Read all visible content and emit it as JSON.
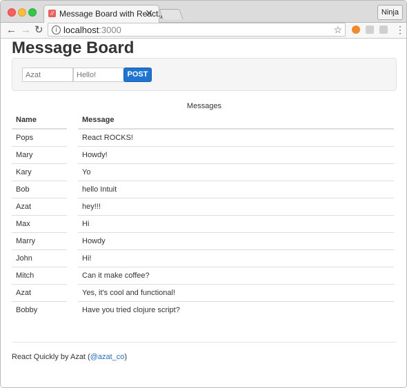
{
  "browser": {
    "tab_title": "Message Board with React.js",
    "tab_close": "✕",
    "profile": "Ninja",
    "url_host": "localhost",
    "url_port": ":3000"
  },
  "page": {
    "title": "Message Board",
    "form": {
      "name_placeholder": "Azat",
      "message_placeholder": "Hello!",
      "post_label": "POST"
    },
    "table": {
      "caption": "Messages",
      "headers": {
        "name": "Name",
        "message": "Message"
      },
      "rows": [
        {
          "name": "Pops",
          "message": "React ROCKS!"
        },
        {
          "name": "Mary",
          "message": "Howdy!"
        },
        {
          "name": "Kary",
          "message": "Yo"
        },
        {
          "name": "Bob",
          "message": "hello Intuit"
        },
        {
          "name": "Azat",
          "message": "hey!!!"
        },
        {
          "name": "Max",
          "message": "Hi"
        },
        {
          "name": "Marry",
          "message": "Howdy"
        },
        {
          "name": "John",
          "message": "Hi!"
        },
        {
          "name": "Mitch",
          "message": "Can it make coffee?"
        },
        {
          "name": "Azat",
          "message": "Yes, it's cool and functional!"
        },
        {
          "name": "Bobby",
          "message": "Have you tried clojure script?"
        }
      ]
    },
    "footer": {
      "prefix": "React Quickly by Azat (",
      "link": "@azat_co",
      "suffix": ")"
    }
  },
  "colors": {
    "post_button": "#1f74cf",
    "link": "#2a6ebd"
  }
}
